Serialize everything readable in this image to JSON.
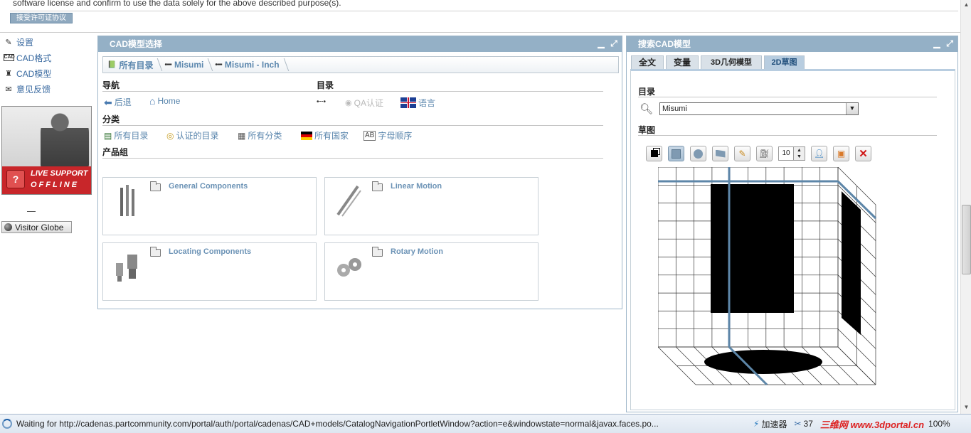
{
  "license": {
    "text": "software license and confirm to use the data solely for the above described purpose(s).",
    "accept_button": "接受许可证协议"
  },
  "left_nav": {
    "items": [
      {
        "label": "设置",
        "icon": "pencil-icon"
      },
      {
        "label": "CAD格式",
        "icon": "cad-format-icon"
      },
      {
        "label": "CAD模型",
        "icon": "cad-model-icon"
      },
      {
        "label": "意见反馈",
        "icon": "envelope-icon"
      }
    ],
    "live_support": {
      "line1": "LIVE SUPPORT",
      "line2": "OFFLINE",
      "badge": "?"
    },
    "visitor_globe": "Visitor Globe"
  },
  "cad_panel": {
    "title": "CAD模型选择",
    "breadcrumb": [
      "所有目录",
      "Misumi",
      "Misumi - Inch"
    ],
    "sections": {
      "nav": "导航",
      "catalog": "目录",
      "category": "分类",
      "product_group": "产品组"
    },
    "nav_links": [
      {
        "label": "后退",
        "icon": "back-arrow-icon"
      },
      {
        "label": "Home",
        "icon": "home-icon"
      }
    ],
    "catalog_links": [
      {
        "label": "QA认证",
        "icon": "qa-certified-icon",
        "disabled": true
      },
      {
        "label": "语言",
        "icon": "uk-flag-icon",
        "disabled": false
      }
    ],
    "category_links": [
      {
        "label": "所有目录",
        "icon": "all-catalogs-icon"
      },
      {
        "label": "认证的目录",
        "icon": "certified-catalog-icon"
      },
      {
        "label": "所有分类",
        "icon": "all-categories-icon"
      },
      {
        "label": "所有国家",
        "icon": "german-flag-icon"
      },
      {
        "label": "字母顺序",
        "icon": "alphabet-icon"
      }
    ],
    "product_groups": [
      {
        "name": "General Components"
      },
      {
        "name": "Linear Motion"
      },
      {
        "name": "Locating Components"
      },
      {
        "name": "Rotary Motion"
      }
    ]
  },
  "search_panel": {
    "title": "搜索CAD模型",
    "tabs": [
      {
        "label": "全文",
        "active": false
      },
      {
        "label": "变量",
        "active": false
      },
      {
        "label": "3D几何模型",
        "active": false
      },
      {
        "label": "2D草图",
        "active": true
      }
    ],
    "catalog_label": "目录",
    "catalog_value": "Misumi",
    "sketch_label": "草图",
    "grid_size": "10",
    "search_button": "搜索"
  },
  "status_bar": {
    "url": "Waiting for http://cadenas.partcommunity.com/portal/auth/portal/cadenas/CAD+models/CatalogNavigationPortletWindow?action=e&windowstate=normal&javax.faces.po...",
    "accelerator": "加速器",
    "count": "37",
    "watermark": "三维网 www.3dportal.cn",
    "zoom": "100%"
  },
  "colors": {
    "panel_header": "#94b0c6",
    "link": "#5a86ad",
    "sketch_line": "#5d86a8",
    "support_red": "#c8262a"
  }
}
